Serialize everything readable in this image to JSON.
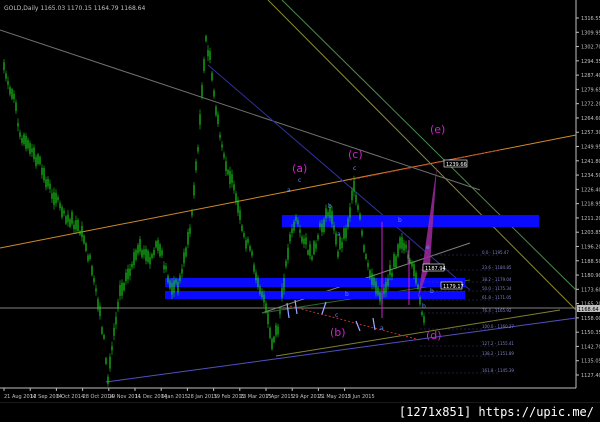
{
  "window": {
    "title": "GOLD,Daily  1165.03 1170.15 1164.79 1168.64"
  },
  "colors": {
    "background": "#000000",
    "candle": "#19c819",
    "axis_text": "#c0c0c0",
    "wave_label": "#d020d0",
    "small_label": "#5f8fff",
    "band": "#0a0aff",
    "fib_text": "#8080c0"
  },
  "price_axis": {
    "ticks": [
      "1316.55",
      "1309.95",
      "1302.70",
      "1294.35",
      "1287.40",
      "1279.65",
      "1272.20",
      "1264.60",
      "1257.30",
      "1249.95",
      "1241.80",
      "1234.50",
      "1226.40",
      "1218.95",
      "1211.20",
      "1203.85",
      "1196.20",
      "1188.50",
      "1180.90",
      "1173.60",
      "1165.20",
      "1158.00",
      "1150.35",
      "1142.70",
      "1135.05",
      "1127.40"
    ],
    "current_price": "1168.64"
  },
  "time_axis": {
    "labels": [
      "21 Aug 2014",
      "12 Sep 2014",
      "6 Oct 2014",
      "28 Oct 2014",
      "19 Nov 2014",
      "11 Dec 2014",
      "6 Jan 2015",
      "28 Jan 2015",
      "19 Feb 2015",
      "13 Mar 2015",
      "7 Apr 2015",
      "29 Apr 2015",
      "21 May 2015",
      "12 Jun 2015"
    ]
  },
  "wave_labels": {
    "a": "(a)",
    "b": "(b)",
    "c": "(c)",
    "d": "(d)",
    "e": "(e)"
  },
  "small_labels": {
    "c1": "c",
    "a1": "a",
    "b1": "b",
    "c2": "c",
    "b2": "b",
    "a2": "a",
    "b3": "b",
    "c3": "c",
    "a3": "a",
    "b4": "b",
    "e1": "e",
    "b5": "b"
  },
  "price_boxes": {
    "top": "1239.66",
    "mid1": "1187.94",
    "mid2": "1179.17"
  },
  "fib_levels": [
    "0.0 - 1195.47",
    "23.6 - 1184.85",
    "38.2 - 1179.04",
    "50.0 - 1175.34",
    "61.8 - 1171.05",
    "76.4 - 1165.92",
    "100.0 - 1160.27",
    "127.2 - 1155.41",
    "138.2 - 1151.89",
    "161.8 - 1145.39"
  ],
  "footer": {
    "text": "[1271x851] https://upic.me/"
  }
}
